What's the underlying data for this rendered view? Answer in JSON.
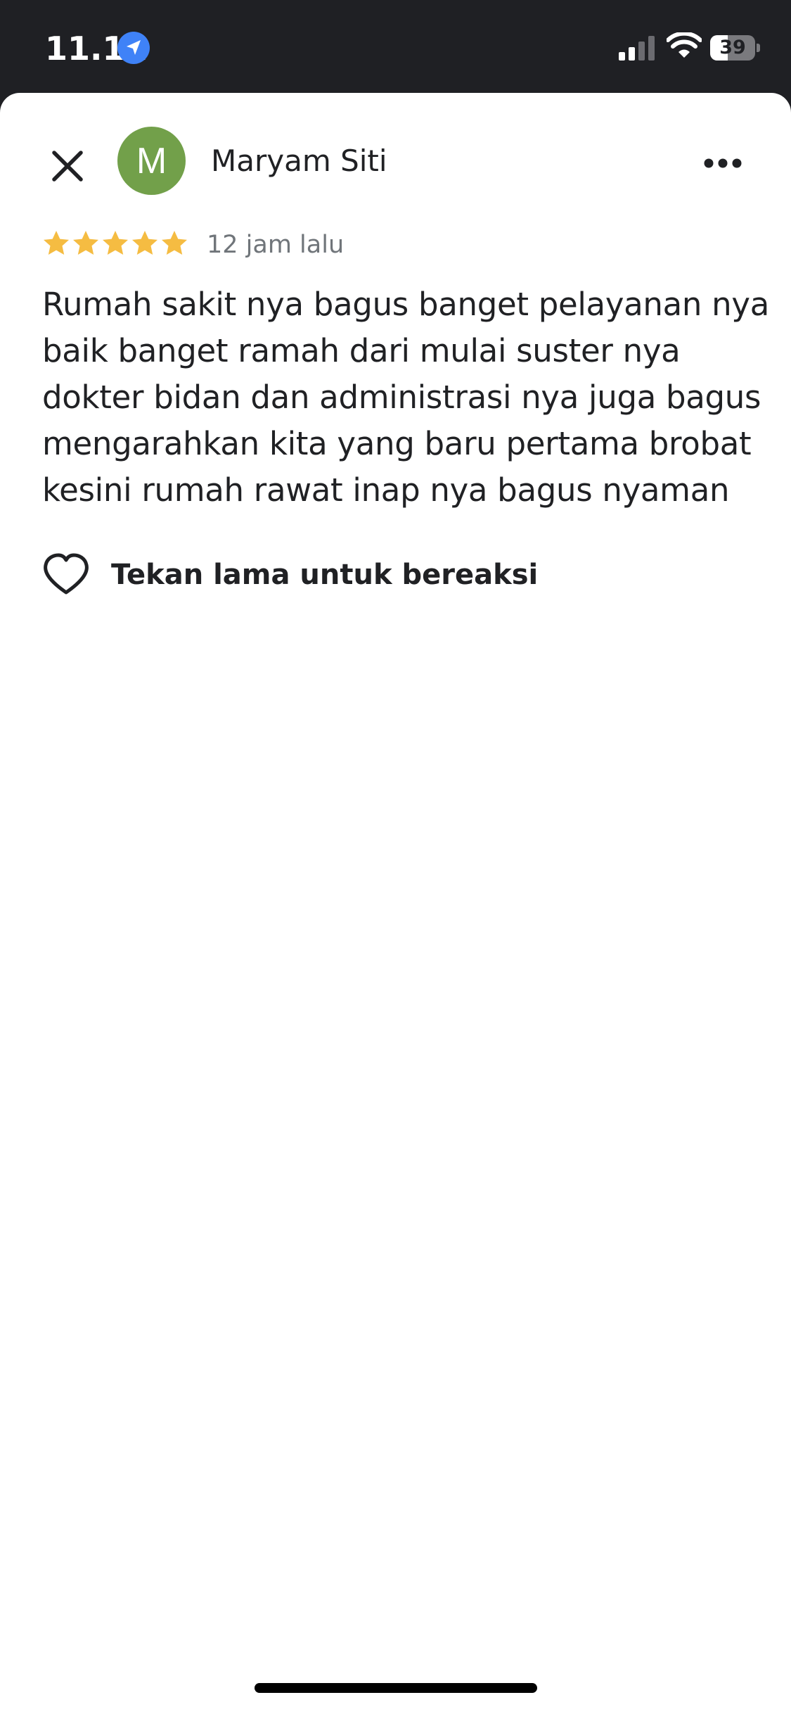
{
  "status_bar": {
    "time": "11.11",
    "battery_level": "39",
    "battery_fraction": 0.39
  },
  "review": {
    "author": "Maryam Siti",
    "avatar_initial": "M",
    "rating": 5,
    "rating_max": 5,
    "time_ago": "12 jam lalu",
    "text_lines": [
      "Rumah sakit nya bagus banget pelayanan nya",
      "baik banget ramah dari mulai suster nya",
      "dokter bidan dan administrasi nya juga bagus",
      "mengarahkan kita yang baru pertama brobat",
      "kesini rumah rawat inap nya bagus nyaman"
    ]
  },
  "actions": {
    "react_label": "Tekan lama untuk bereaksi"
  },
  "colors": {
    "star": "#f5bc42",
    "avatar_bg": "#72a04a",
    "status_bar_bg": "#1f2024",
    "location_badge": "#3f82f7"
  },
  "icons": {
    "close": "close-icon",
    "more": "more-horizontal-icon",
    "react": "heart-outline-icon",
    "location": "location-arrow-icon"
  }
}
